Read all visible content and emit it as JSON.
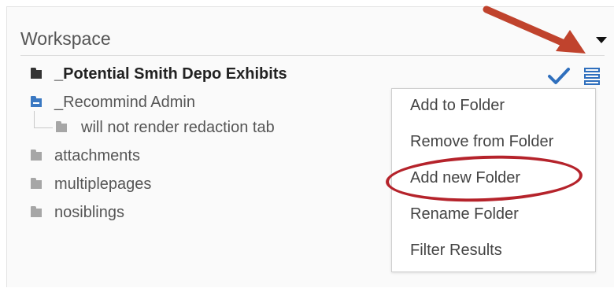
{
  "workspace": {
    "title": "Workspace"
  },
  "tree": {
    "items": [
      {
        "label": "_Potential Smith Depo Exhibits",
        "icon": "folder-icon",
        "style": "bold"
      },
      {
        "label": "_Recommind Admin",
        "icon": "folder-open-icon",
        "style": "normal"
      },
      {
        "label": "will not render redaction tab",
        "icon": "folder-icon",
        "style": "child"
      },
      {
        "label": "attachments",
        "icon": "folder-icon",
        "style": "normal"
      },
      {
        "label": "multiplepages",
        "icon": "folder-icon",
        "style": "normal"
      },
      {
        "label": "nosiblings",
        "icon": "folder-icon",
        "style": "normal"
      }
    ]
  },
  "menu": {
    "items": [
      {
        "label": "Add to Folder"
      },
      {
        "label": "Remove from Folder"
      },
      {
        "label": "Add new Folder"
      },
      {
        "label": "Rename Folder"
      },
      {
        "label": "Filter Results"
      }
    ]
  },
  "colors": {
    "annotation": "#b5232b",
    "accent": "#3a78c2",
    "text": "#444444"
  }
}
